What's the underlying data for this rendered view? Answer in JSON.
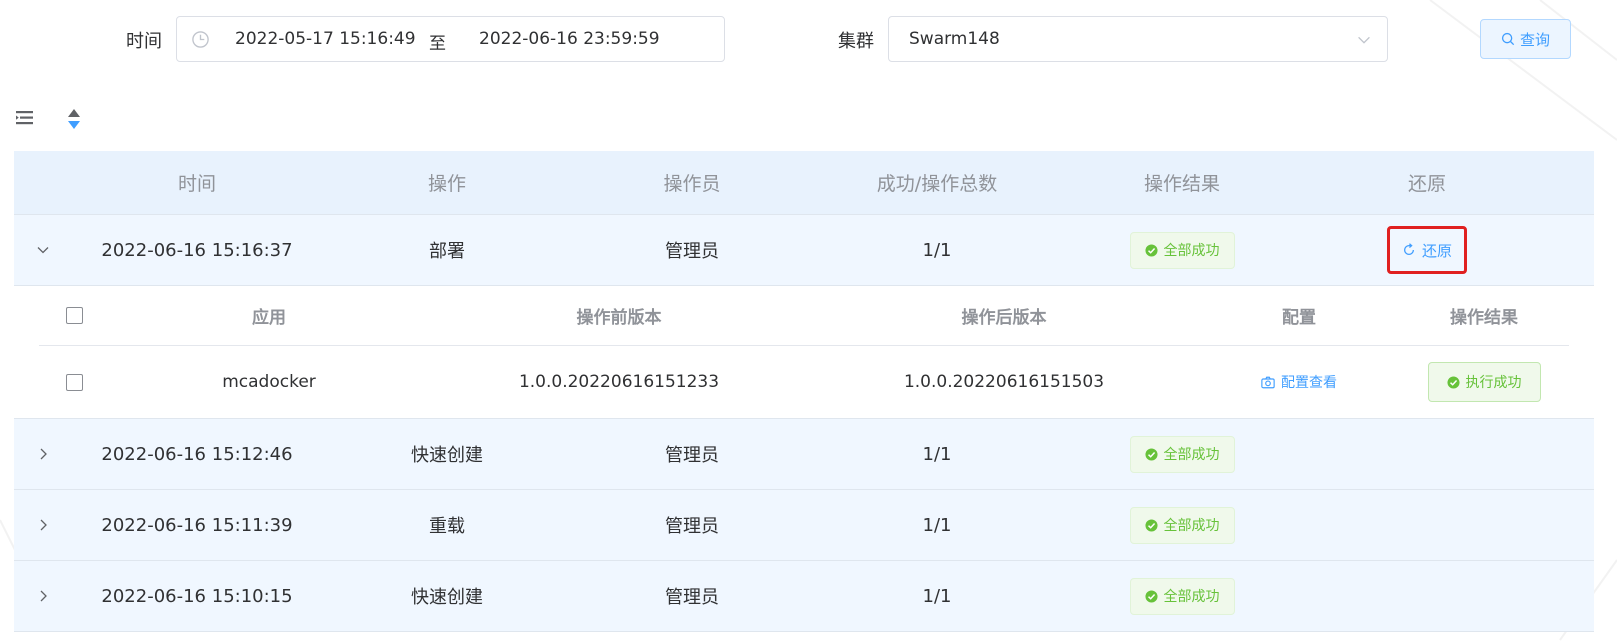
{
  "filter": {
    "time_label": "时间",
    "start_date": "2022-05-17 15:16:49",
    "range_separator": "至",
    "end_date": "2022-06-16 23:59:59",
    "cluster_label": "集群",
    "cluster_value": "Swarm148",
    "query_label": "查询"
  },
  "table": {
    "headers": {
      "time": "时间",
      "operation": "操作",
      "operator": "操作员",
      "count": "成功/操作总数",
      "result": "操作结果",
      "restore": "还原"
    },
    "rows": [
      {
        "time": "2022-06-16 15:16:37",
        "operation": "部署",
        "operator": "管理员",
        "count": "1/1",
        "result": "全部成功",
        "restore": "还原"
      },
      {
        "time": "2022-06-16 15:12:46",
        "operation": "快速创建",
        "operator": "管理员",
        "count": "1/1",
        "result": "全部成功"
      },
      {
        "time": "2022-06-16 15:11:39",
        "operation": "重载",
        "operator": "管理员",
        "count": "1/1",
        "result": "全部成功"
      },
      {
        "time": "2022-06-16 15:10:15",
        "operation": "快速创建",
        "operator": "管理员",
        "count": "1/1",
        "result": "全部成功"
      }
    ],
    "sub_table": {
      "headers": {
        "app": "应用",
        "before": "操作前版本",
        "after": "操作后版本",
        "config": "配置",
        "result": "操作结果"
      },
      "rows": [
        {
          "app": "mcadocker",
          "before": "1.0.0.20220616151233",
          "after": "1.0.0.20220616151503",
          "config": "配置查看",
          "result": "执行成功"
        }
      ]
    }
  },
  "colors": {
    "accent": "#409eff",
    "success": "#67c23a",
    "highlight_border": "#e02020",
    "header_bg": "#e8f2fd",
    "row_bg": "#f0f7ff"
  }
}
